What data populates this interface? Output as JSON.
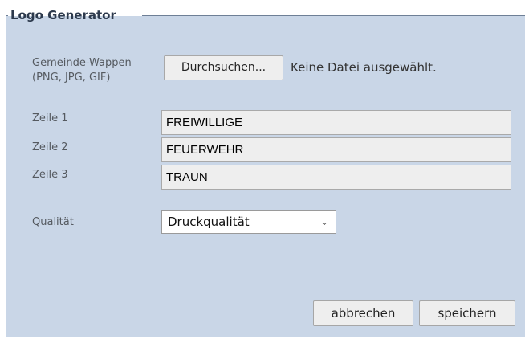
{
  "legend": "Logo Generator",
  "wappen": {
    "label_line1": "Gemeinde-Wappen",
    "label_line2": "(PNG, JPG, GIF)",
    "browse_label": "Durchsuchen...",
    "status": "Keine Datei ausgewählt."
  },
  "lines": [
    {
      "label": "Zeile 1",
      "value": "FREIWILLIGE"
    },
    {
      "label": "Zeile 2",
      "value": "FEUERWEHR"
    },
    {
      "label": "Zeile 3",
      "value": "TRAUN"
    }
  ],
  "quality": {
    "label": "Qualität",
    "selected": "Druckqualität",
    "chevron": "⌄"
  },
  "buttons": {
    "cancel": "abbrechen",
    "save": "speichern"
  }
}
